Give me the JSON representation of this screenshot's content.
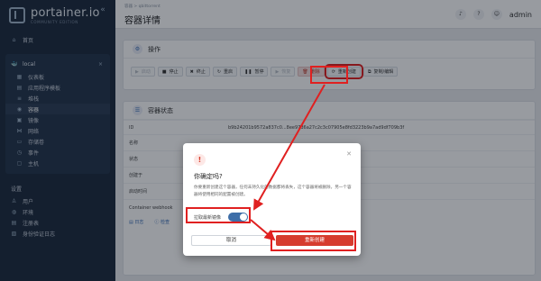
{
  "brand": {
    "name": "portainer.io",
    "subtitle": "COMMUNITY EDITION",
    "collapse": "«"
  },
  "sidebar": {
    "home": "首页",
    "env_name": "local",
    "env_close": "×",
    "items": [
      {
        "label": "仪表板",
        "icon": "▦"
      },
      {
        "label": "应用程序模板",
        "icon": "▤"
      },
      {
        "label": "堆栈",
        "icon": "≡"
      },
      {
        "label": "容器",
        "icon": "◉"
      },
      {
        "label": "镜像",
        "icon": "▣"
      },
      {
        "label": "网络",
        "icon": "⋈"
      },
      {
        "label": "存储卷",
        "icon": "▭"
      },
      {
        "label": "事件",
        "icon": "◷"
      },
      {
        "label": "主机",
        "icon": "▢"
      }
    ],
    "settings_title": "设置",
    "settings_items": [
      {
        "label": "用户",
        "icon": "♙"
      },
      {
        "label": "环境",
        "icon": "◍"
      },
      {
        "label": "注册表",
        "icon": "▤"
      },
      {
        "label": "身份验证日志",
        "icon": "▧"
      }
    ]
  },
  "topbar": {
    "breadcrumb": "容器 > qbittorrent",
    "title": "容器详情",
    "user": "admin"
  },
  "ops": {
    "title": "操作",
    "buttons": [
      "启动",
      "停止",
      "终止",
      "重启",
      "暂停",
      "恢复",
      "删除",
      "重新创建",
      "复制/编辑"
    ]
  },
  "status": {
    "title": "容器状态",
    "rows": [
      {
        "k": "ID",
        "v": "b9b24201b9572a837c0...8ee97d6a27c2c3c07905e8fd3223b9a7ad9df709b3f"
      },
      {
        "k": "名称",
        "v": ""
      },
      {
        "k": "状态",
        "v": ""
      },
      {
        "k": "创建于",
        "v": ""
      },
      {
        "k": "启动时间",
        "v": ""
      },
      {
        "k": "Container webhook",
        "v": ""
      }
    ],
    "links": [
      "日志",
      "检查"
    ]
  },
  "modal": {
    "title": "你确定吗?",
    "body": "你要重新创建这个容器，任何未持久化的数据都将丢失，这个容器将被删除，另一个容器将使用相同的配置被创建。",
    "toggle_label": "拉取最新镜像",
    "toggle_on": true,
    "cancel": "取消",
    "confirm": "重新创建"
  },
  "colors": {
    "danger": "#d63c2e",
    "sidebar": "#1c2a3d",
    "accent": "#3e6ea8",
    "highlight": "#e02020"
  }
}
